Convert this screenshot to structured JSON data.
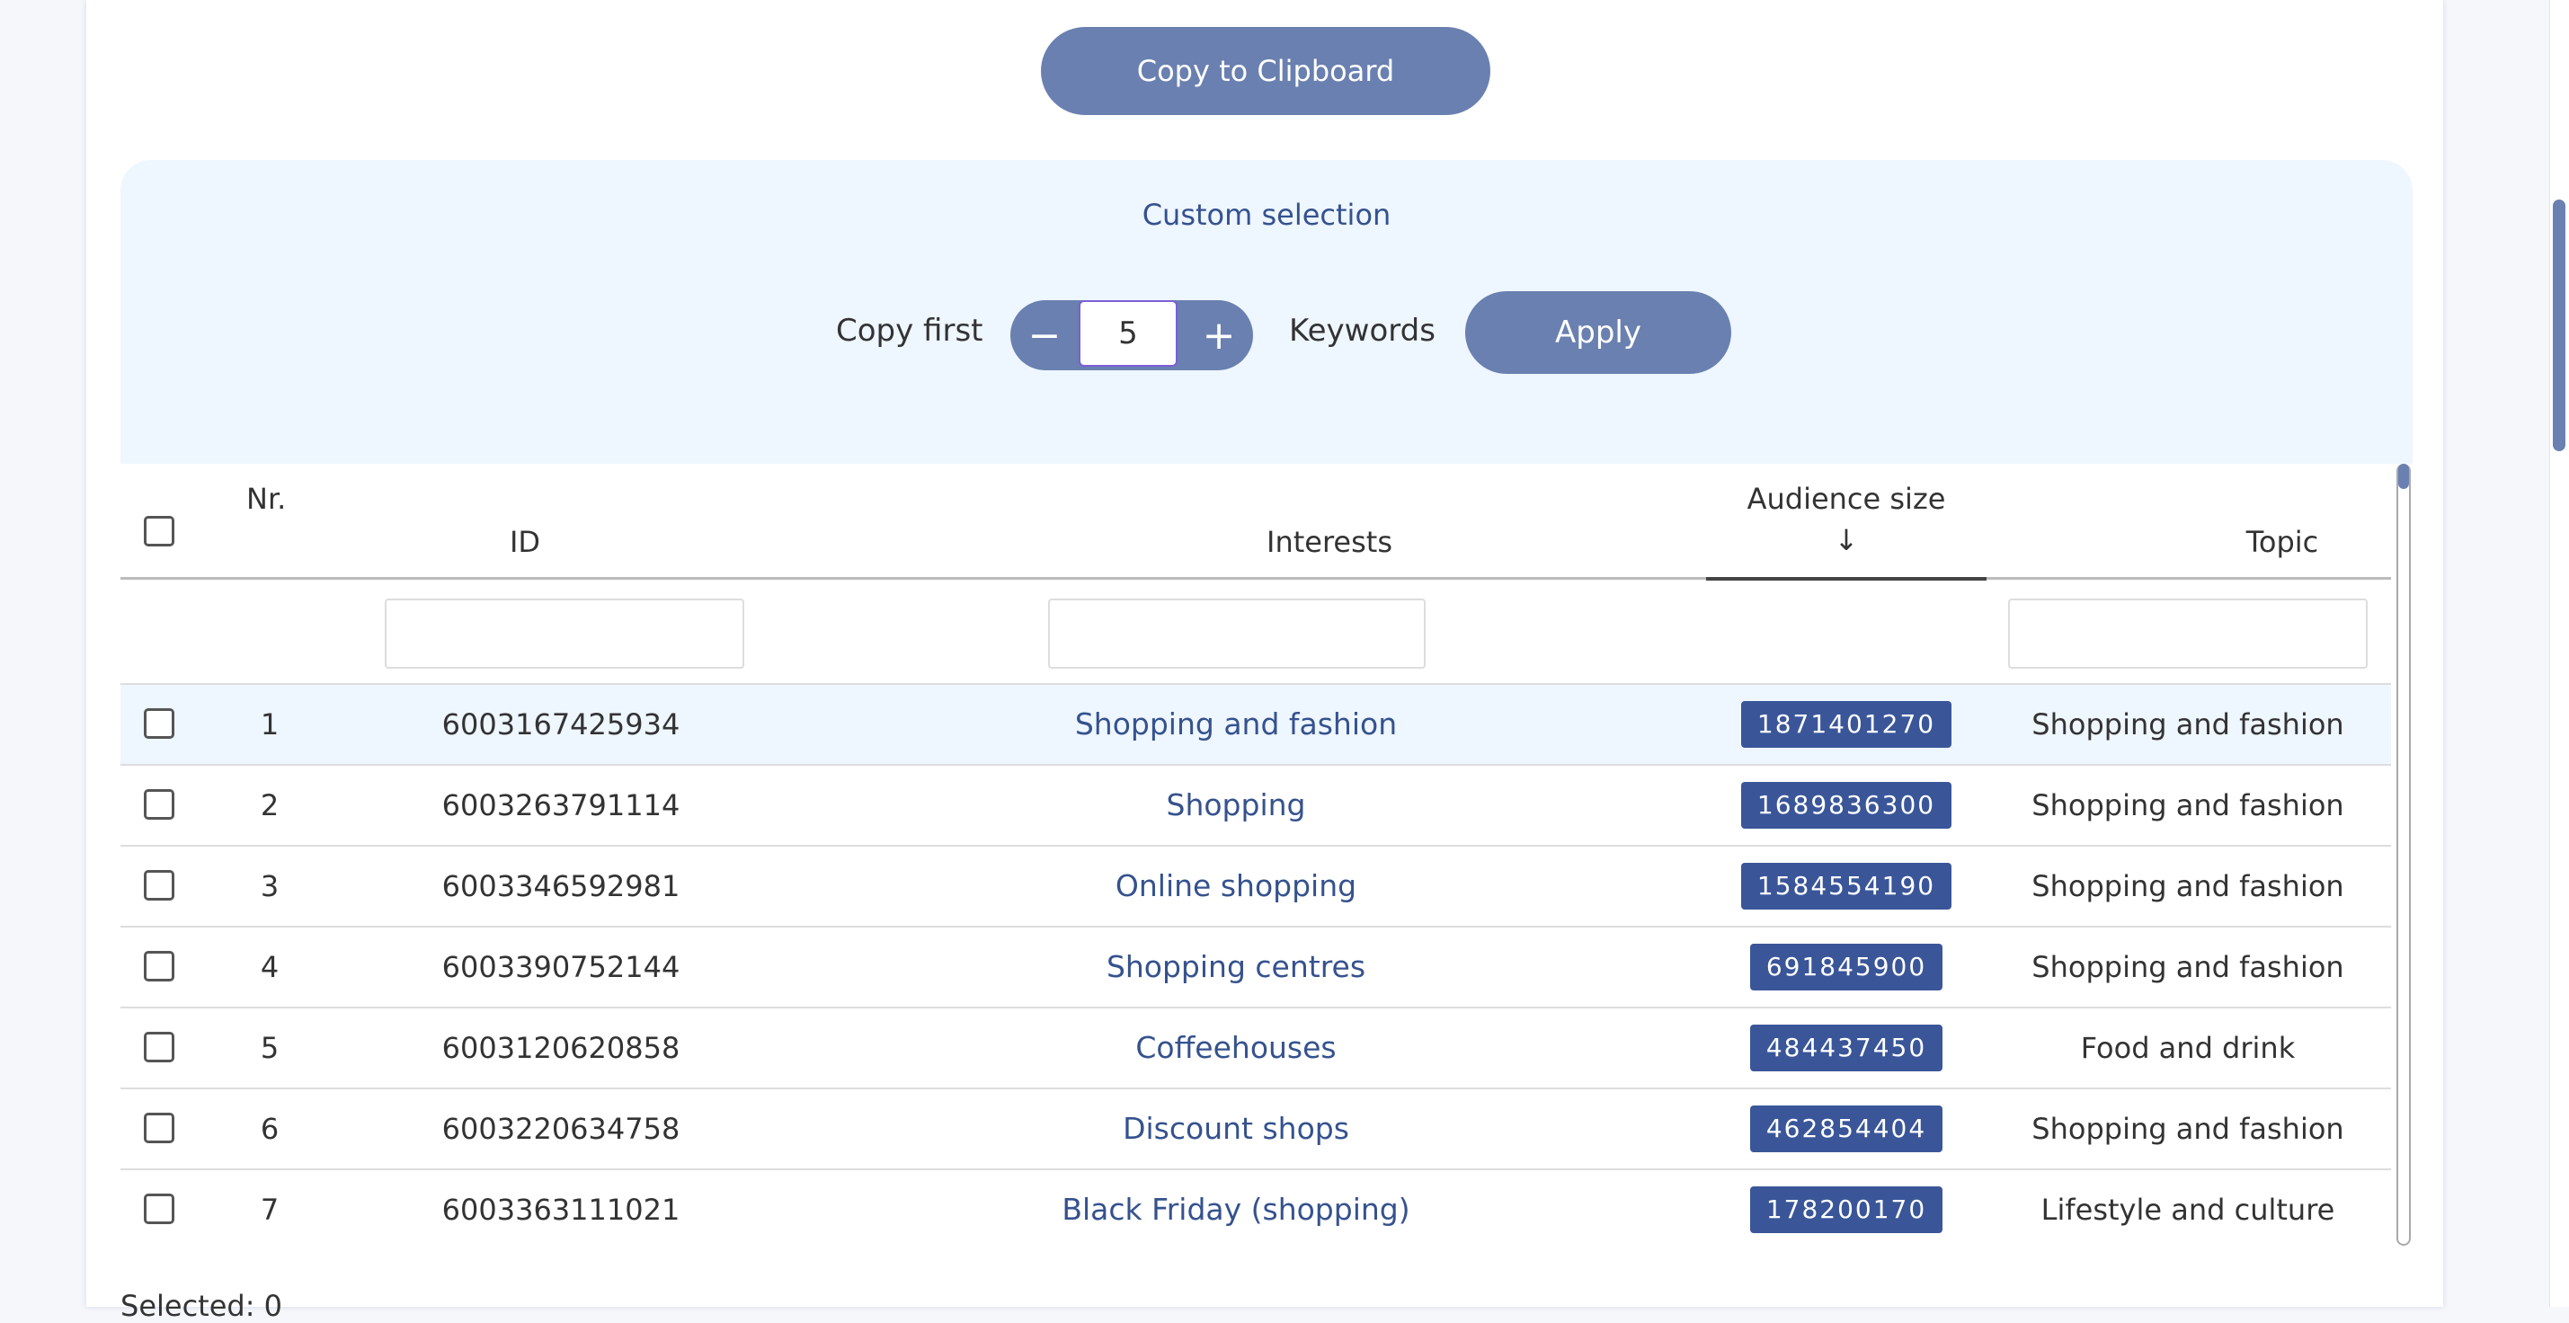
{
  "toolbar": {
    "copy_label": "Copy to Clipboard"
  },
  "custom_selection": {
    "title": "Custom selection",
    "copy_first_label": "Copy first",
    "minus": "−",
    "plus": "+",
    "count_value": "5",
    "keywords_label": "Keywords",
    "apply_label": "Apply"
  },
  "table": {
    "headers": {
      "nr": "Nr.",
      "id": "ID",
      "interests": "Interests",
      "audience": "Audience size",
      "sort_arrow": "↓",
      "topic": "Topic"
    },
    "rows": [
      {
        "nr": "1",
        "id": "6003167425934",
        "interest": "Shopping and fashion",
        "audience": "1871401270",
        "topic": "Shopping and fashion"
      },
      {
        "nr": "2",
        "id": "6003263791114",
        "interest": "Shopping",
        "audience": "1689836300",
        "topic": "Shopping and fashion"
      },
      {
        "nr": "3",
        "id": "6003346592981",
        "interest": "Online shopping",
        "audience": "1584554190",
        "topic": "Shopping and fashion"
      },
      {
        "nr": "4",
        "id": "6003390752144",
        "interest": "Shopping centres",
        "audience": "691845900",
        "topic": "Shopping and fashion"
      },
      {
        "nr": "5",
        "id": "6003120620858",
        "interest": "Coffeehouses",
        "audience": "484437450",
        "topic": "Food and drink"
      },
      {
        "nr": "6",
        "id": "6003220634758",
        "interest": "Discount shops",
        "audience": "462854404",
        "topic": "Shopping and fashion"
      },
      {
        "nr": "7",
        "id": "6003363111021",
        "interest": "Black Friday (shopping)",
        "audience": "178200170",
        "topic": "Lifestyle and culture"
      }
    ]
  },
  "footer": {
    "selected": "Selected: 0"
  }
}
